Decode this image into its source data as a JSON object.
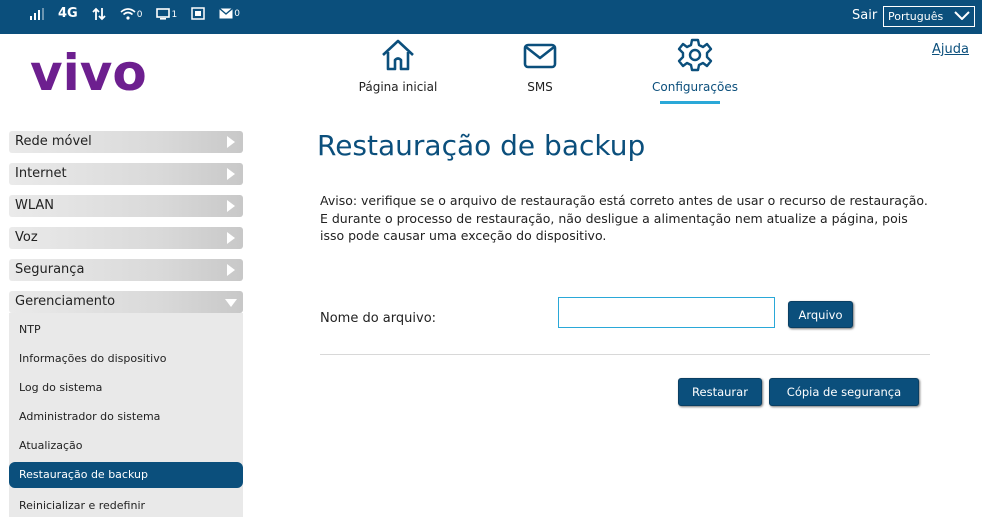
{
  "status_bar": {
    "signal_label": "4G",
    "wifi_count": "0",
    "devices_count": "1",
    "messages_count": "0",
    "logout_label": "Sair",
    "language_selected": "Português"
  },
  "logo_text": "vivo",
  "top_nav": {
    "items": [
      {
        "label": "Página inicial",
        "icon": "home-icon"
      },
      {
        "label": "SMS",
        "icon": "envelope-icon"
      },
      {
        "label": "Configurações",
        "icon": "gear-icon"
      }
    ],
    "help_label": "Ajuda"
  },
  "sidebar": {
    "main_items": [
      {
        "label": "Rede móvel"
      },
      {
        "label": "Internet"
      },
      {
        "label": "WLAN"
      },
      {
        "label": "Voz"
      },
      {
        "label": "Segurança"
      },
      {
        "label": "Gerenciamento"
      }
    ],
    "sub_items": [
      {
        "label": "NTP"
      },
      {
        "label": "Informações do dispositivo"
      },
      {
        "label": "Log do sistema"
      },
      {
        "label": "Administrador do sistema"
      },
      {
        "label": "Atualização"
      },
      {
        "label": "Restauração de backup"
      },
      {
        "label": "Reinicializar e redefinir"
      }
    ],
    "active_sub": "Restauração de backup"
  },
  "main": {
    "title": "Restauração de backup",
    "warning": "Aviso: verifique se o arquivo de restauração está correto antes de usar o recurso de restauração. E durante o processo de restauração, não desligue a alimentação nem atualize a página, pois isso pode causar uma exceção do dispositivo.",
    "file_label": "Nome do arquivo:",
    "file_value": "",
    "file_button": "Arquivo",
    "restore_button": "Restaurar",
    "backup_button": "Cópia de segurança"
  },
  "colors": {
    "brand_blue": "#0b4f7c",
    "brand_purple": "#6d1f8f",
    "accent_cyan": "#2aa8d8"
  }
}
